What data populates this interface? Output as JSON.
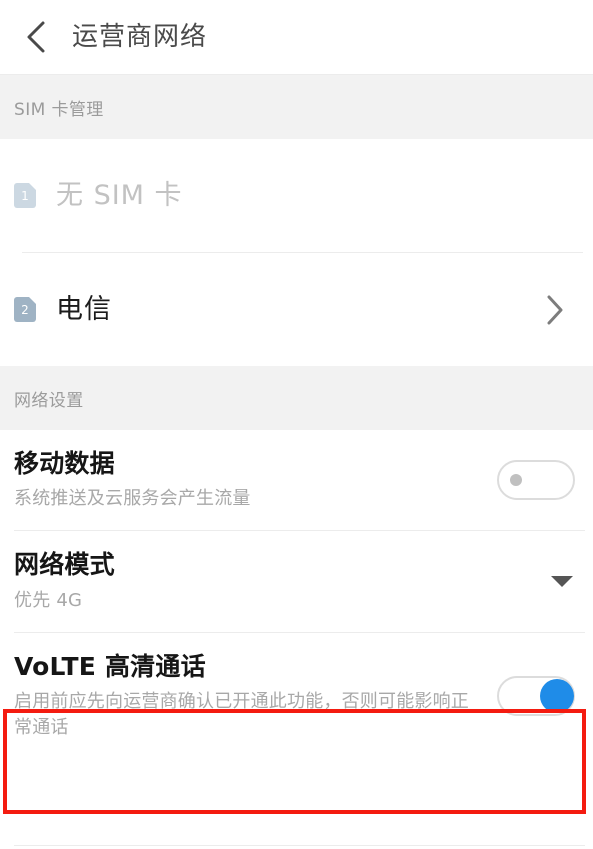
{
  "header": {
    "back_icon": "chevron-left-icon",
    "title": "运营商网络"
  },
  "sections": {
    "sim_management": {
      "label": "SIM 卡管理",
      "rows": [
        {
          "badge": "1",
          "title": "无 SIM 卡",
          "state": "disabled",
          "accessory": "none"
        },
        {
          "badge": "2",
          "title": "电信",
          "state": "enabled",
          "accessory": "chevron-right-icon"
        }
      ]
    },
    "network_settings": {
      "label": "网络设置",
      "rows": [
        {
          "title": "移动数据",
          "subtitle": "系统推送及云服务会产生流量",
          "control": "toggle",
          "toggle_state": "off"
        },
        {
          "title": "网络模式",
          "subtitle": "优先 4G",
          "control": "dropdown",
          "dropdown_icon": "caret-down-icon"
        },
        {
          "title": "VoLTE 高清通话",
          "subtitle": "启用前应先向运营商确认已开通此功能，否则可能影响正常通话",
          "control": "toggle",
          "toggle_state": "on",
          "highlighted": "true"
        }
      ]
    }
  },
  "colors": {
    "accent_on": "#1f8ce8",
    "highlight_box": "#f41b10",
    "sim1_badge": "#ccd8e2",
    "sim2_badge": "#9fb3c4",
    "section_band": "#f2f2f2"
  }
}
